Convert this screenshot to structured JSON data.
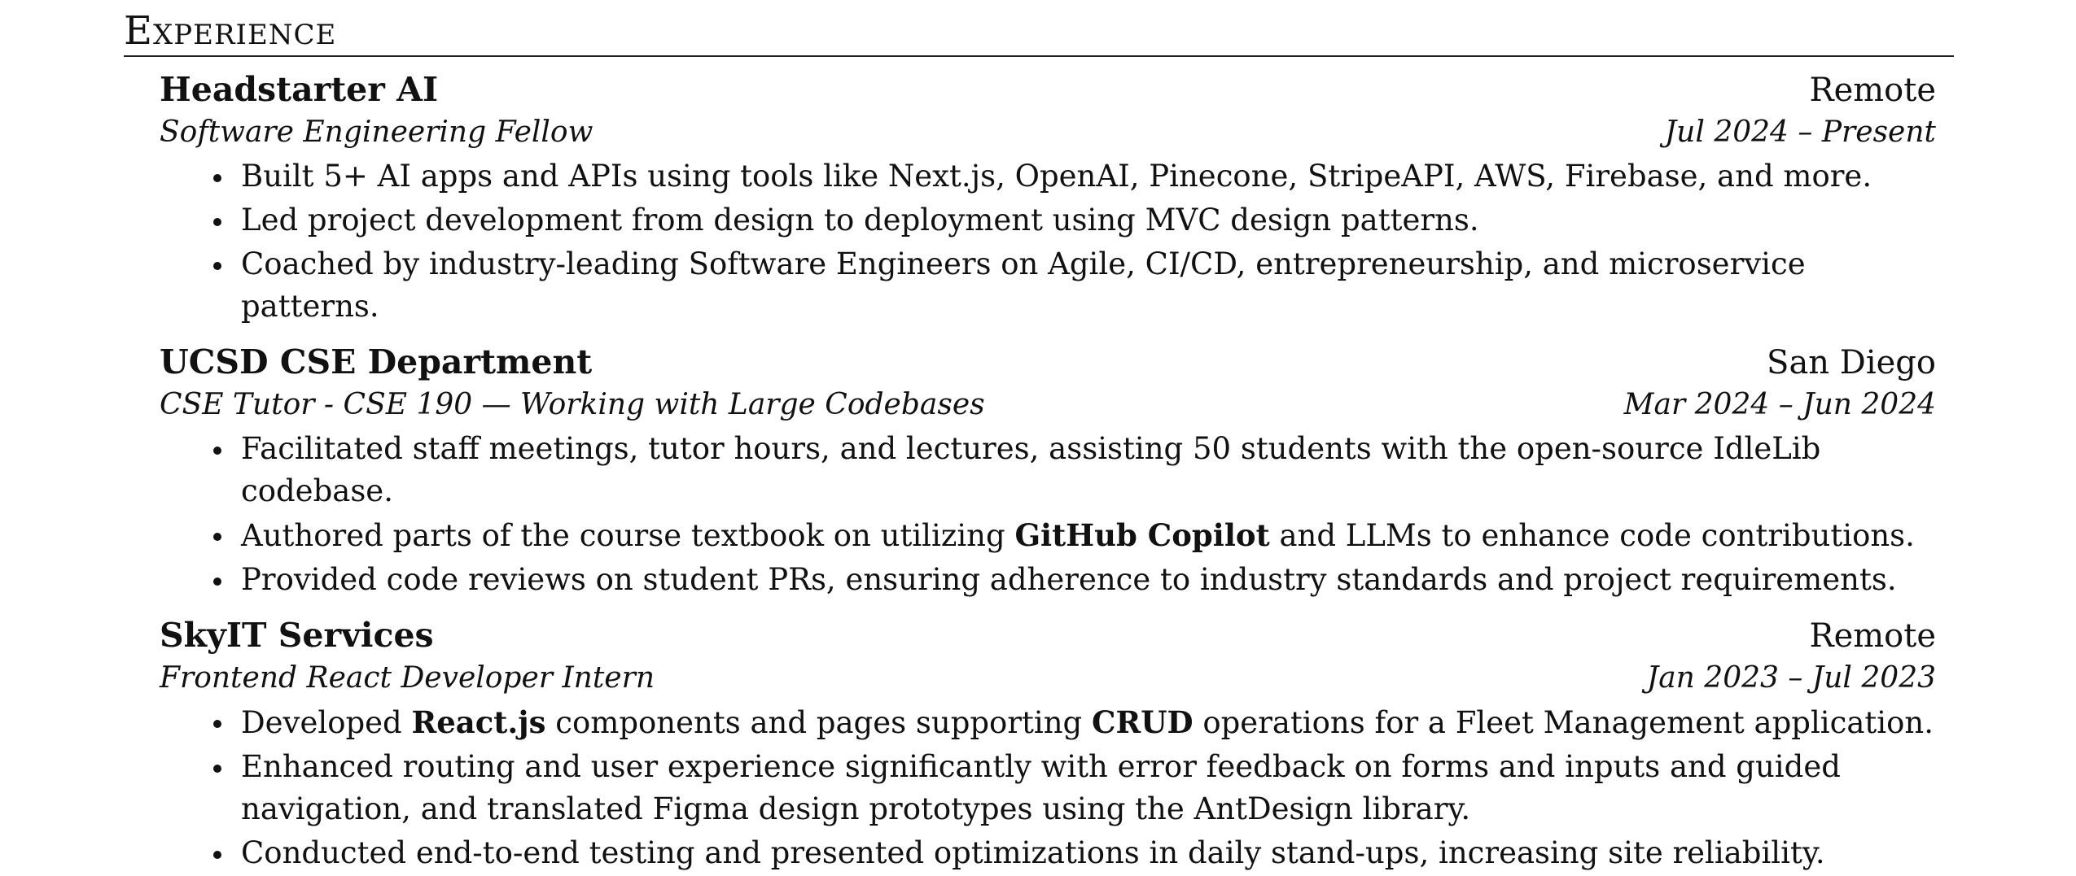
{
  "section": {
    "title": "Experience"
  },
  "entries": [
    {
      "company": "Headstarter AI",
      "location": "Remote",
      "role": "Software Engineering Fellow",
      "dates": "Jul 2024 – Present",
      "bullets": [
        {
          "text": "Built 5+ AI apps and APIs using tools like Next.js, OpenAI, Pinecone, StripeAPI, AWS, Firebase, and more."
        },
        {
          "text": "Led project development from design to deployment using MVC design patterns."
        },
        {
          "text": "Coached by industry-leading Software Engineers on Agile, CI/CD, entrepreneurship, and microservice patterns."
        }
      ]
    },
    {
      "company": "UCSD CSE Department",
      "location": "San Diego",
      "role": "CSE Tutor - CSE 190 — Working with Large Codebases",
      "dates": "Mar 2024 – Jun 2024",
      "bullets": [
        {
          "text": "Facilitated staff meetings, tutor hours, and lectures, assisting 50 students with the open-source IdleLib codebase."
        },
        {
          "pre": "Authored parts of the course textbook on utilizing ",
          "bold1": "GitHub Copilot",
          "post": " and LLMs to enhance code contributions."
        },
        {
          "text": "Provided code reviews on student PRs, ensuring adherence to industry standards and project requirements."
        }
      ]
    },
    {
      "company": "SkyIT Services",
      "location": "Remote",
      "role": "Frontend React Developer Intern",
      "dates": "Jan 2023 – Jul 2023",
      "bullets": [
        {
          "pre": "Developed ",
          "bold1": "React.js",
          "mid": " components and pages supporting ",
          "bold2": "CRUD",
          "post": " operations for a Fleet Management application."
        },
        {
          "text": "Enhanced routing and user experience significantly with error feedback on forms and inputs and guided navigation, and translated Figma design prototypes using the AntDesign library."
        },
        {
          "text": "Conducted end-to-end testing and presented optimizations in daily stand-ups, increasing site reliability."
        }
      ]
    }
  ]
}
